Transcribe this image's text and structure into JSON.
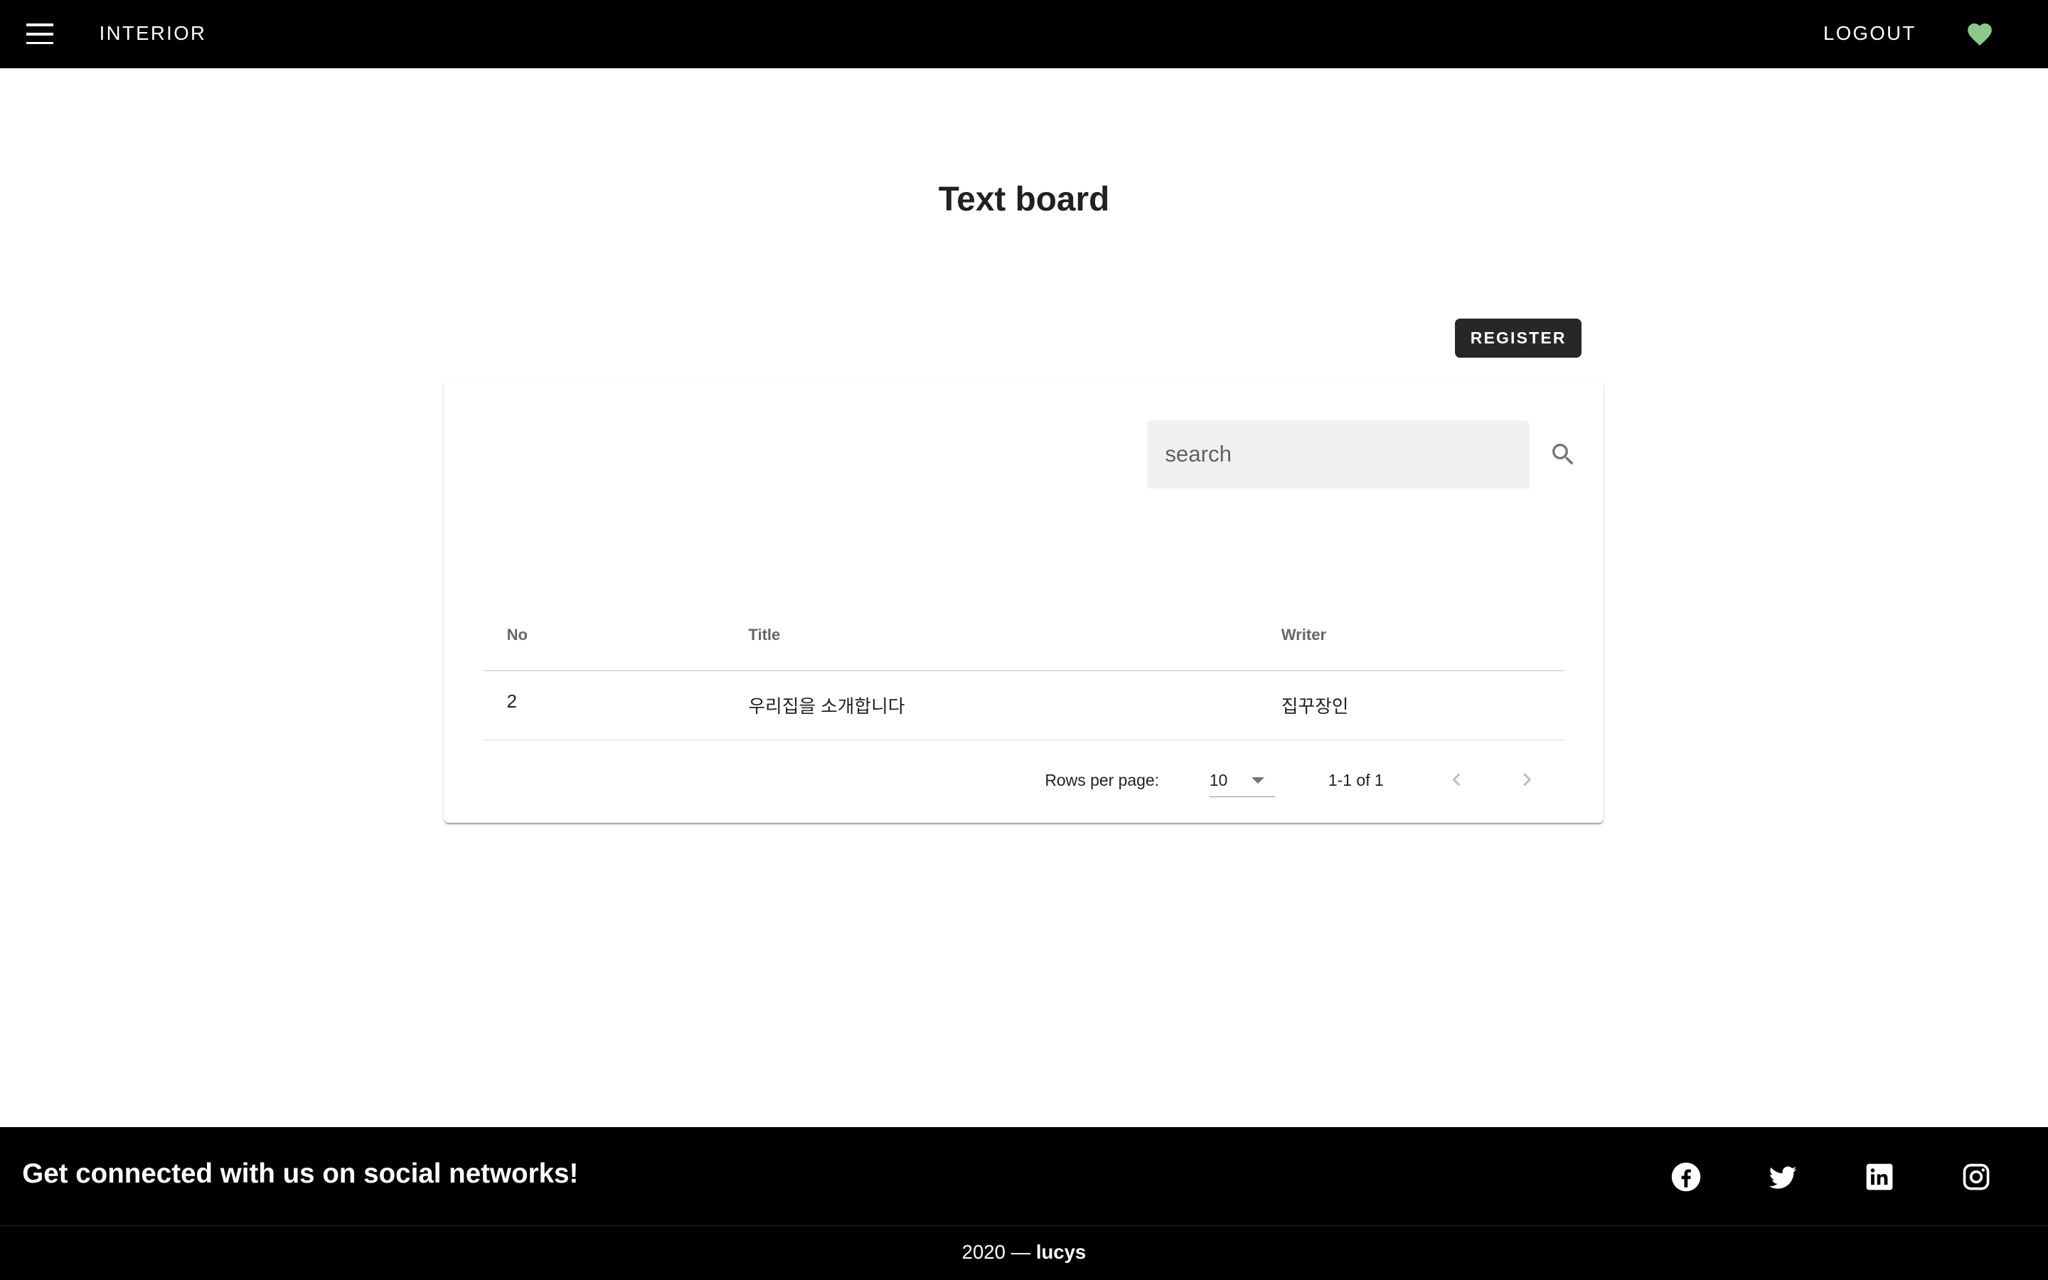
{
  "header": {
    "menu_icon": "hamburger-icon",
    "brand": "Interior",
    "logout_label": "Logout",
    "favorite_icon": "heart-icon",
    "favorite_color": "#8bc98b"
  },
  "main": {
    "title": "Text board",
    "register_label": "Register",
    "search": {
      "placeholder": "search",
      "value": "",
      "icon": "search-icon"
    },
    "table": {
      "columns": [
        "No",
        "Title",
        "Writer"
      ],
      "rows": [
        {
          "no": "2",
          "title": "우리집을 소개합니다",
          "writer": "집꾸장인"
        }
      ]
    },
    "pagination": {
      "rows_per_page_label": "Rows per page:",
      "rows_per_page_value": "10",
      "range_text": "1-1 of 1",
      "prev_icon": "chevron-left-icon",
      "next_icon": "chevron-right-icon"
    }
  },
  "footer": {
    "tagline": "Get connected with us on social networks!",
    "social_icons": [
      "facebook-icon",
      "twitter-icon",
      "linkedin-icon",
      "instagram-icon"
    ],
    "copyright_prefix": "2020 — ",
    "copyright_name": "lucys"
  }
}
